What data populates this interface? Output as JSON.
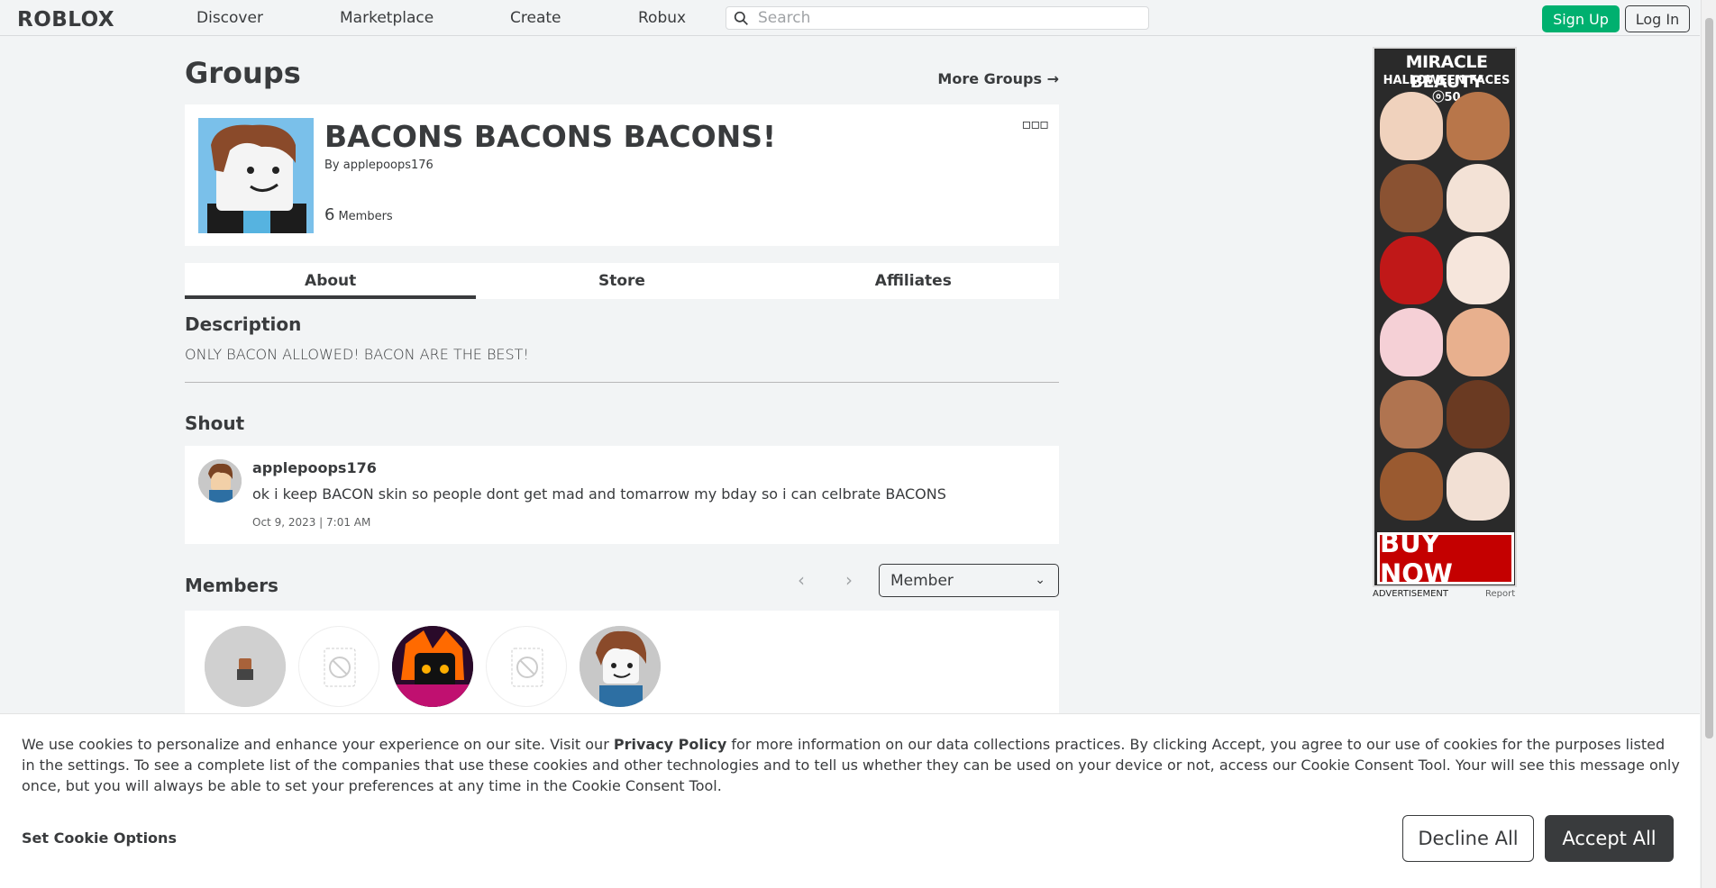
{
  "header": {
    "logo": "ROBLOX",
    "nav": [
      "Discover",
      "Marketplace",
      "Create",
      "Robux"
    ],
    "search_placeholder": "Search",
    "signup_label": "Sign Up",
    "login_label": "Log In"
  },
  "page": {
    "title": "Groups",
    "more_groups": "More Groups →"
  },
  "group": {
    "name": "BACONS BACONS BACONS!",
    "owner": "By applepoops176",
    "member_count": "6",
    "member_label": "Members",
    "menu_glyph": "▫▫▫"
  },
  "tabs": [
    {
      "label": "About",
      "active": true
    },
    {
      "label": "Store",
      "active": false
    },
    {
      "label": "Affiliates",
      "active": false
    }
  ],
  "description": {
    "title": "Description",
    "text": "ONLY BACON ALLOWED! BACON ARE THE BEST!"
  },
  "shout": {
    "title": "Shout",
    "user": "applepoops176",
    "message": "ok i keep BACON skin so people dont get mad and tomarrow my bday so i can celbrate BACONS",
    "date": "Oct 9, 2023 | 7:01 AM"
  },
  "members": {
    "title": "Members",
    "role_selected": "Member",
    "prev_glyph": "‹",
    "next_glyph": "›"
  },
  "ad": {
    "title": "MIRACLE BEAUTY",
    "subtitle": "HALLOWEEN FACES ⓞ50",
    "cta": "BUY NOW",
    "label": "ADVERTISEMENT",
    "report": "Report"
  },
  "cookie": {
    "text_before": "We use cookies to personalize and enhance your experience on our site. Visit our ",
    "privacy_link": "Privacy Policy",
    "text_after": " for more information on our data collections practices. By clicking Accept, you agree to our use of cookies for the purposes listed in the settings. To see a complete list of the companies that use these cookies and other technologies and to tell us whether they can be used on your device or not, access our Cookie Consent Tool. Your will see this message only once, but you will always be able to set your preferences at any time in the Cookie Consent Tool.",
    "set_options": "Set Cookie Options",
    "decline": "Decline All",
    "accept": "Accept All"
  }
}
